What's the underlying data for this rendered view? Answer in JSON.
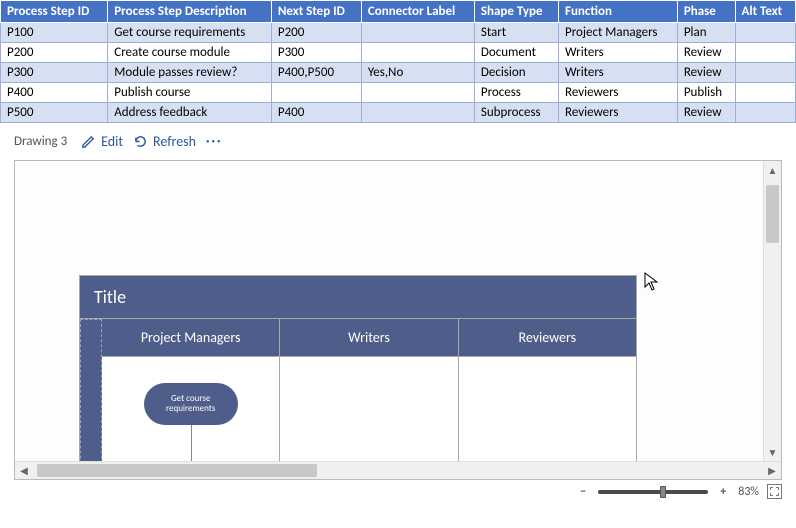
{
  "table": {
    "headers": [
      "Process Step ID",
      "Process Step Description",
      "Next Step ID",
      "Connector Label",
      "Shape Type",
      "Function",
      "Phase",
      "Alt Text"
    ],
    "rows": [
      [
        "P100",
        "Get course requirements",
        "P200",
        "",
        "Start",
        "Project Managers",
        "Plan",
        ""
      ],
      [
        "P200",
        "Create course module",
        "P300",
        "",
        "Document",
        "Writers",
        "Review",
        ""
      ],
      [
        "P300",
        "Module passes review?",
        "P400,P500",
        "Yes,No",
        "Decision",
        "Writers",
        "Review",
        ""
      ],
      [
        "P400",
        "Publish course",
        "",
        "",
        "Process",
        "Reviewers",
        "Publish",
        ""
      ],
      [
        "P500",
        "Address feedback",
        "P400",
        "",
        "Subprocess",
        "Reviewers",
        "Review",
        ""
      ]
    ]
  },
  "toolbar": {
    "drawing_label": "Drawing 3",
    "edit_label": "Edit",
    "refresh_label": "Refresh"
  },
  "swimlane": {
    "title": "Title",
    "lanes": [
      "Project Managers",
      "Writers",
      "Reviewers"
    ],
    "start_shape_label": "Get course requirements"
  },
  "zoom": {
    "value": "83%"
  }
}
